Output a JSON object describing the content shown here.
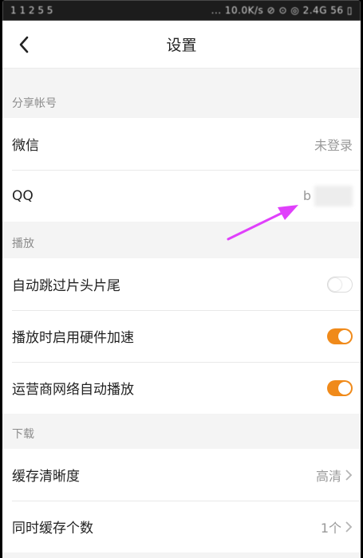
{
  "status": {
    "time": "1 1 2 5 5",
    "right": "... 10.0K/s ⊘ ⊙ ◎ 2.4G 56 ▯"
  },
  "nav": {
    "title": "设置",
    "back_icon": "chevron-left-icon"
  },
  "sections": {
    "share": {
      "header": "分享帐号",
      "wechat": {
        "label": "微信",
        "value": "未登录"
      },
      "qq": {
        "label": "QQ",
        "value": "b"
      }
    },
    "play": {
      "header": "播放",
      "skip": {
        "label": "自动跳过片头片尾",
        "on": false
      },
      "hw": {
        "label": "播放时启用硬件加速",
        "on": true
      },
      "carrier": {
        "label": "运营商网络自动播放",
        "on": true
      }
    },
    "download": {
      "header": "下载",
      "quality": {
        "label": "缓存清晰度",
        "value": "高清"
      },
      "concurrent": {
        "label": "同时缓存个数",
        "value": "1个"
      }
    }
  },
  "colors": {
    "accent": "#f08a1a",
    "annotation": "#e040fb"
  }
}
